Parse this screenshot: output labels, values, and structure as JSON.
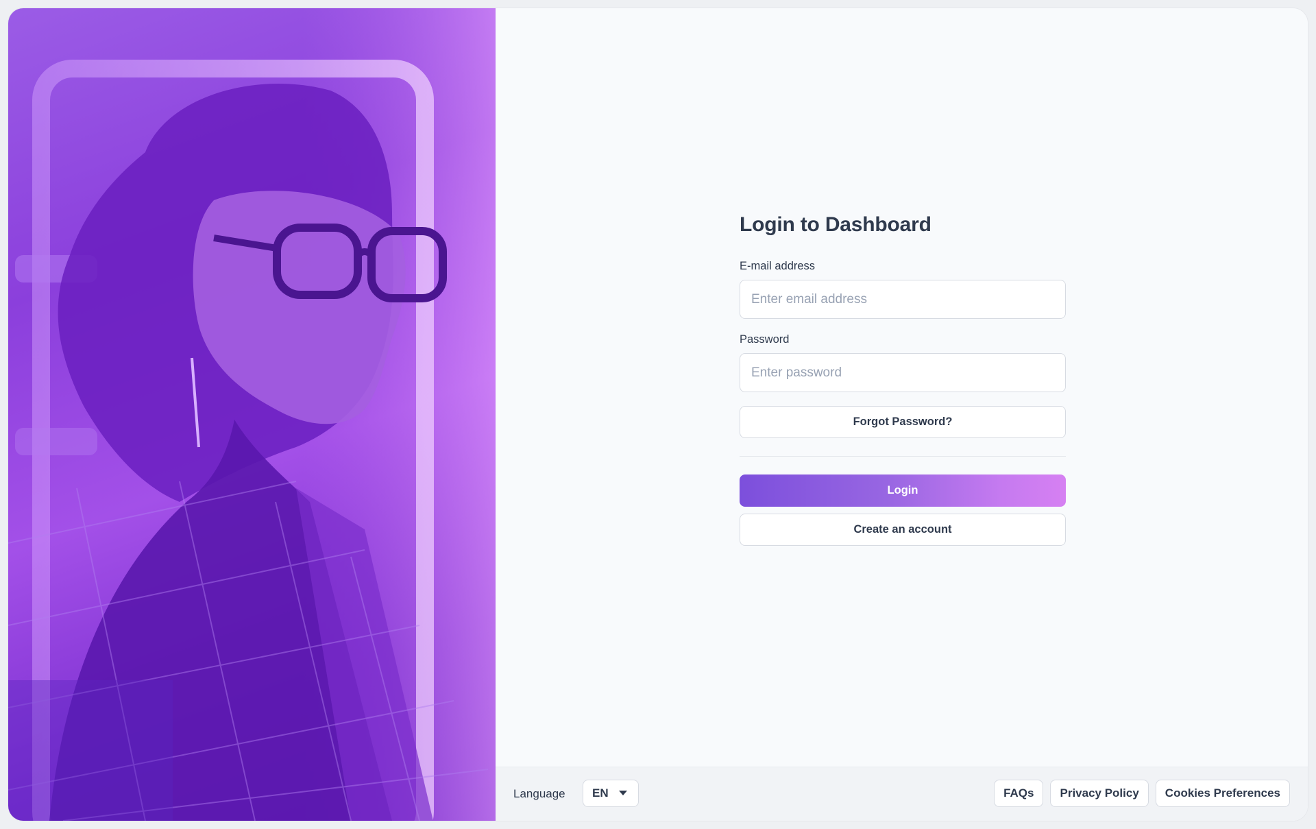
{
  "login": {
    "title": "Login to Dashboard",
    "email_label": "E-mail address",
    "email_placeholder": "Enter email address",
    "email_value": "",
    "password_label": "Password",
    "password_placeholder": "Enter password",
    "password_value": "",
    "forgot_label": "Forgot Password?",
    "login_label": "Login",
    "create_label": "Create an account"
  },
  "footer": {
    "language_label": "Language",
    "language_value": "EN",
    "links": [
      "FAQs",
      "Privacy Policy",
      "Cookies Preferences"
    ]
  },
  "hero": {
    "image": "woman-with-glasses-portrait",
    "tint_color": "#9b4fe6"
  },
  "colors": {
    "accent_start": "#7c4fdc",
    "accent_end": "#d680f2",
    "text": "#2f3a4d"
  }
}
